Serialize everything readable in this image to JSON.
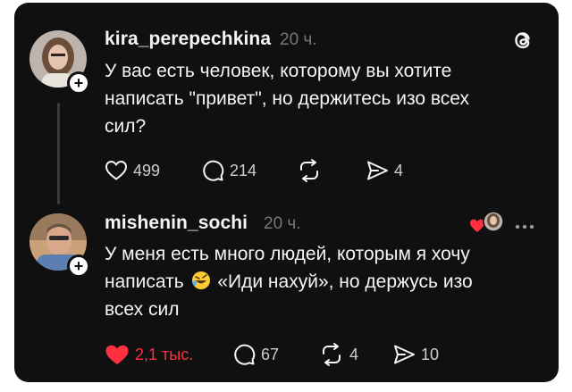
{
  "post": {
    "username": "kira_perepechkina",
    "time": "20 ч.",
    "text_lines": [
      "У вас есть человек, которому вы хотите",
      "написать \"привет\", но держитесь изо всех",
      "сил?"
    ],
    "likes": "499",
    "replies": "214",
    "shares": "4"
  },
  "reply": {
    "username": "mishenin_sochi",
    "time": "20 ч.",
    "text_line1": "У меня есть много людей, которым я хочу",
    "text_line2_before": "написать",
    "text_line2_after": "«Иди нахуй», но держусь изо",
    "text_line3": "всех сил",
    "likes": "2,1 тыс.",
    "replies": "67",
    "reposts": "4",
    "shares": "10",
    "emoji": "rolling-on-floor-laughing-emoji"
  },
  "colors": {
    "background": "#101010",
    "text": "#f3f5f7",
    "muted": "#777777",
    "like_red": "#ff3040"
  }
}
